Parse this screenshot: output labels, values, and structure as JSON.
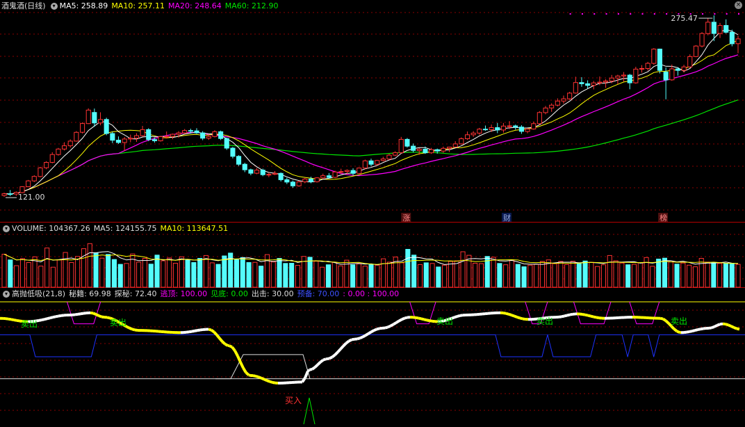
{
  "header_main": {
    "title": "酒鬼酒(日线)",
    "ma5": "MA5: 258.89",
    "ma10": "MA10: 257.11",
    "ma20": "MA20: 248.64",
    "ma60": "MA60: 212.90",
    "high_label": "275.47",
    "low_label": "121.00"
  },
  "event_markers": [
    "涨",
    "财",
    "榜"
  ],
  "header_volume": {
    "title": "VOLUME: 104367.26",
    "ma5": "MA5: 124155.75",
    "ma10": "MA10: 113647.51"
  },
  "header_indicator": {
    "title": "高抛低吸(21,8)",
    "mi_ji": "秘籍: 69.98",
    "tan_mi": "探秘: 72.40",
    "tao_ding": "逃顶: 100.00",
    "jian_di": "见底: 0.00",
    "chu_ji": "出击: 30.00",
    "yu_bei": "预备: 70.00",
    "extra": ": 0.00 : 100.00"
  },
  "signals": {
    "sell": "卖出",
    "buy": "买入"
  },
  "colors": {
    "up": "#ff3232",
    "down": "#54fcfc",
    "ma5": "#ffffff",
    "ma10": "#ffff00",
    "ma20": "#ff00ff",
    "ma60": "#00e600",
    "grid": "#8b0000",
    "blue": "#1e32ff"
  },
  "chart_data": {
    "type": "candlestick",
    "price_range": [
      121.0,
      275.47
    ],
    "candles": [
      {
        "o": 121.5,
        "h": 124.0,
        "l": 120.3,
        "c": 123.0
      },
      {
        "o": 123.0,
        "h": 126.2,
        "l": 121.0,
        "c": 122.8
      },
      {
        "o": 122.8,
        "h": 125.0,
        "l": 121.2,
        "c": 124.2
      },
      {
        "o": 124.0,
        "h": 129.5,
        "l": 123.5,
        "c": 129.0
      },
      {
        "o": 129.0,
        "h": 134.8,
        "l": 128.6,
        "c": 134.0
      },
      {
        "o": 134.0,
        "h": 138.8,
        "l": 133.0,
        "c": 137.8
      },
      {
        "o": 137.8,
        "h": 146.0,
        "l": 137.0,
        "c": 145.2
      },
      {
        "o": 145.2,
        "h": 150.8,
        "l": 144.0,
        "c": 149.8
      },
      {
        "o": 149.8,
        "h": 158.5,
        "l": 149.0,
        "c": 156.5
      },
      {
        "o": 156.5,
        "h": 162.2,
        "l": 155.6,
        "c": 161.2
      },
      {
        "o": 161.2,
        "h": 167.0,
        "l": 160.0,
        "c": 164.0
      },
      {
        "o": 164.0,
        "h": 169.5,
        "l": 162.5,
        "c": 168.0
      },
      {
        "o": 168.0,
        "h": 176.5,
        "l": 167.5,
        "c": 175.5
      },
      {
        "o": 175.5,
        "h": 184.0,
        "l": 174.5,
        "c": 183.0
      },
      {
        "o": 183.0,
        "h": 196.0,
        "l": 182.6,
        "c": 194.5
      },
      {
        "o": 192.5,
        "h": 195.8,
        "l": 180.2,
        "c": 183.5
      },
      {
        "o": 183.5,
        "h": 192.6,
        "l": 181.5,
        "c": 186.5
      },
      {
        "o": 186.5,
        "h": 188.0,
        "l": 173.0,
        "c": 174.5
      },
      {
        "o": 174.5,
        "h": 176.0,
        "l": 166.3,
        "c": 168.8
      },
      {
        "o": 168.8,
        "h": 172.0,
        "l": 165.6,
        "c": 166.8
      },
      {
        "o": 166.8,
        "h": 171.5,
        "l": 159.5,
        "c": 169.8
      },
      {
        "o": 169.8,
        "h": 173.5,
        "l": 167.0,
        "c": 170.5
      },
      {
        "o": 170.5,
        "h": 174.8,
        "l": 167.3,
        "c": 172.6
      },
      {
        "o": 172.6,
        "h": 181.0,
        "l": 172.0,
        "c": 177.8
      },
      {
        "o": 177.8,
        "h": 179.0,
        "l": 168.0,
        "c": 169.3
      },
      {
        "o": 169.3,
        "h": 171.0,
        "l": 166.7,
        "c": 168.3
      },
      {
        "o": 168.3,
        "h": 172.5,
        "l": 167.6,
        "c": 171.8
      },
      {
        "o": 171.8,
        "h": 176.2,
        "l": 170.2,
        "c": 172.0
      },
      {
        "o": 172.0,
        "h": 174.5,
        "l": 169.6,
        "c": 173.8
      },
      {
        "o": 173.8,
        "h": 176.5,
        "l": 171.0,
        "c": 175.0
      },
      {
        "o": 175.0,
        "h": 178.3,
        "l": 174.0,
        "c": 177.0
      },
      {
        "o": 177.0,
        "h": 178.6,
        "l": 174.4,
        "c": 176.7
      },
      {
        "o": 176.7,
        "h": 179.0,
        "l": 174.3,
        "c": 175.0
      },
      {
        "o": 175.0,
        "h": 176.5,
        "l": 168.8,
        "c": 170.5
      },
      {
        "o": 170.5,
        "h": 173.7,
        "l": 169.0,
        "c": 171.9
      },
      {
        "o": 171.9,
        "h": 177.3,
        "l": 171.2,
        "c": 176.0
      },
      {
        "o": 176.0,
        "h": 177.0,
        "l": 168.9,
        "c": 170.2
      },
      {
        "o": 170.2,
        "h": 171.0,
        "l": 160.5,
        "c": 162.0
      },
      {
        "o": 162.0,
        "h": 163.0,
        "l": 153.2,
        "c": 155.0
      },
      {
        "o": 155.0,
        "h": 156.0,
        "l": 146.7,
        "c": 148.2
      },
      {
        "o": 148.2,
        "h": 149.5,
        "l": 141.5,
        "c": 143.5
      },
      {
        "o": 143.5,
        "h": 144.5,
        "l": 138.8,
        "c": 140.5
      },
      {
        "o": 140.5,
        "h": 145.0,
        "l": 139.7,
        "c": 143.2
      },
      {
        "o": 143.2,
        "h": 144.5,
        "l": 138.0,
        "c": 139.3
      },
      {
        "o": 139.3,
        "h": 141.3,
        "l": 137.2,
        "c": 139.6
      },
      {
        "o": 139.6,
        "h": 142.4,
        "l": 138.9,
        "c": 140.4
      },
      {
        "o": 140.4,
        "h": 141.3,
        "l": 133.5,
        "c": 135.0
      },
      {
        "o": 135.0,
        "h": 136.7,
        "l": 131.3,
        "c": 133.0
      },
      {
        "o": 133.0,
        "h": 134.3,
        "l": 128.1,
        "c": 129.8
      },
      {
        "o": 129.8,
        "h": 134.0,
        "l": 129.0,
        "c": 133.2
      },
      {
        "o": 133.2,
        "h": 136.5,
        "l": 132.0,
        "c": 135.6
      },
      {
        "o": 135.6,
        "h": 137.6,
        "l": 132.0,
        "c": 133.3
      },
      {
        "o": 133.3,
        "h": 137.2,
        "l": 132.6,
        "c": 136.6
      },
      {
        "o": 136.6,
        "h": 140.2,
        "l": 135.7,
        "c": 138.4
      },
      {
        "o": 138.4,
        "h": 140.7,
        "l": 136.0,
        "c": 137.0
      },
      {
        "o": 137.0,
        "h": 142.7,
        "l": 136.3,
        "c": 141.6
      },
      {
        "o": 141.6,
        "h": 144.4,
        "l": 140.0,
        "c": 142.0
      },
      {
        "o": 142.0,
        "h": 143.9,
        "l": 139.6,
        "c": 142.9
      },
      {
        "o": 142.9,
        "h": 144.8,
        "l": 138.8,
        "c": 140.4
      },
      {
        "o": 140.4,
        "h": 145.5,
        "l": 139.9,
        "c": 145.0
      },
      {
        "o": 145.0,
        "h": 152.2,
        "l": 144.0,
        "c": 151.1
      },
      {
        "o": 151.1,
        "h": 153.0,
        "l": 146.5,
        "c": 148.2
      },
      {
        "o": 148.2,
        "h": 152.0,
        "l": 147.1,
        "c": 151.4
      },
      {
        "o": 151.4,
        "h": 154.6,
        "l": 150.6,
        "c": 152.7
      },
      {
        "o": 152.7,
        "h": 157.2,
        "l": 152.0,
        "c": 156.0
      },
      {
        "o": 156.0,
        "h": 159.3,
        "l": 155.0,
        "c": 158.1
      },
      {
        "o": 158.1,
        "h": 171.6,
        "l": 157.4,
        "c": 169.5
      },
      {
        "o": 169.5,
        "h": 170.6,
        "l": 162.5,
        "c": 163.7
      },
      {
        "o": 163.7,
        "h": 165.9,
        "l": 158.3,
        "c": 160.0
      },
      {
        "o": 160.0,
        "h": 162.0,
        "l": 156.3,
        "c": 161.1
      },
      {
        "o": 161.1,
        "h": 163.4,
        "l": 157.1,
        "c": 158.0
      },
      {
        "o": 158.0,
        "h": 162.2,
        "l": 157.1,
        "c": 160.7
      },
      {
        "o": 160.7,
        "h": 161.6,
        "l": 157.3,
        "c": 159.5
      },
      {
        "o": 159.5,
        "h": 163.3,
        "l": 158.0,
        "c": 161.8
      },
      {
        "o": 161.8,
        "h": 163.2,
        "l": 158.7,
        "c": 162.9
      },
      {
        "o": 162.9,
        "h": 167.9,
        "l": 162.5,
        "c": 165.6
      },
      {
        "o": 165.6,
        "h": 171.2,
        "l": 165.0,
        "c": 170.0
      },
      {
        "o": 170.0,
        "h": 176.2,
        "l": 169.0,
        "c": 173.4
      },
      {
        "o": 173.4,
        "h": 176.5,
        "l": 171.6,
        "c": 174.8
      },
      {
        "o": 174.8,
        "h": 179.3,
        "l": 173.4,
        "c": 178.2
      },
      {
        "o": 178.2,
        "h": 181.3,
        "l": 176.8,
        "c": 177.7
      },
      {
        "o": 177.7,
        "h": 182.1,
        "l": 175.8,
        "c": 179.5
      },
      {
        "o": 179.5,
        "h": 183.5,
        "l": 174.8,
        "c": 177.5
      },
      {
        "o": 177.5,
        "h": 183.5,
        "l": 175.2,
        "c": 180.8
      },
      {
        "o": 180.8,
        "h": 185.1,
        "l": 178.3,
        "c": 181.0
      },
      {
        "o": 181.0,
        "h": 182.1,
        "l": 177.8,
        "c": 180.0
      },
      {
        "o": 180.0,
        "h": 181.6,
        "l": 174.2,
        "c": 176.3
      },
      {
        "o": 176.3,
        "h": 179.1,
        "l": 174.7,
        "c": 178.3
      },
      {
        "o": 178.3,
        "h": 184.7,
        "l": 177.8,
        "c": 182.9
      },
      {
        "o": 182.9,
        "h": 193.6,
        "l": 182.0,
        "c": 192.4
      },
      {
        "o": 192.4,
        "h": 198.0,
        "l": 190.9,
        "c": 196.3
      },
      {
        "o": 196.3,
        "h": 200.3,
        "l": 193.0,
        "c": 198.7
      },
      {
        "o": 198.7,
        "h": 204.5,
        "l": 197.6,
        "c": 202.2
      },
      {
        "o": 202.2,
        "h": 206.9,
        "l": 200.0,
        "c": 204.1
      },
      {
        "o": 204.1,
        "h": 210.1,
        "l": 203.1,
        "c": 209.0
      },
      {
        "o": 209.0,
        "h": 223.0,
        "l": 208.5,
        "c": 218.0
      },
      {
        "o": 218.0,
        "h": 222.6,
        "l": 214.4,
        "c": 217.0
      },
      {
        "o": 217.0,
        "h": 219.9,
        "l": 212.9,
        "c": 215.6
      },
      {
        "o": 215.6,
        "h": 219.4,
        "l": 212.2,
        "c": 217.7
      },
      {
        "o": 217.7,
        "h": 223.2,
        "l": 215.8,
        "c": 218.4
      },
      {
        "o": 218.4,
        "h": 220.9,
        "l": 213.5,
        "c": 219.3
      },
      {
        "o": 219.3,
        "h": 224.5,
        "l": 217.4,
        "c": 221.9
      },
      {
        "o": 221.9,
        "h": 224.7,
        "l": 216.6,
        "c": 223.6
      },
      {
        "o": 223.6,
        "h": 227.0,
        "l": 218.9,
        "c": 224.4
      },
      {
        "o": 224.4,
        "h": 225.4,
        "l": 212.3,
        "c": 217.8
      },
      {
        "o": 217.8,
        "h": 231.5,
        "l": 217.0,
        "c": 229.5
      },
      {
        "o": 229.5,
        "h": 232.9,
        "l": 226.5,
        "c": 230.0
      },
      {
        "o": 230.0,
        "h": 235.7,
        "l": 228.2,
        "c": 234.4
      },
      {
        "o": 234.4,
        "h": 247.4,
        "l": 233.2,
        "c": 246.6
      },
      {
        "o": 246.6,
        "h": 247.0,
        "l": 225.8,
        "c": 228.4
      },
      {
        "o": 227.0,
        "h": 230.9,
        "l": 203.7,
        "c": 220.3
      },
      {
        "o": 220.3,
        "h": 233.4,
        "l": 219.5,
        "c": 229.7
      },
      {
        "o": 229.7,
        "h": 231.1,
        "l": 223.9,
        "c": 228.4
      },
      {
        "o": 228.4,
        "h": 233.2,
        "l": 226.5,
        "c": 231.4
      },
      {
        "o": 231.4,
        "h": 242.1,
        "l": 230.5,
        "c": 240.2
      },
      {
        "o": 240.2,
        "h": 250.0,
        "l": 239.7,
        "c": 249.2
      },
      {
        "o": 249.2,
        "h": 261.1,
        "l": 248.0,
        "c": 259.9
      },
      {
        "o": 259.9,
        "h": 273.0,
        "l": 258.4,
        "c": 269.6
      },
      {
        "o": 269.6,
        "h": 275.4,
        "l": 253.4,
        "c": 260.0
      },
      {
        "o": 260.0,
        "h": 269.0,
        "l": 256.1,
        "c": 266.8
      },
      {
        "o": 266.8,
        "h": 272.0,
        "l": 259.9,
        "c": 261.0
      },
      {
        "o": 261.0,
        "h": 263.2,
        "l": 249.0,
        "c": 251.2
      },
      {
        "o": 251.2,
        "h": 258.0,
        "l": 243.0,
        "c": 255.3
      }
    ],
    "ma5": [],
    "volume_range": [
      0,
      240000
    ],
    "volume": [
      150000,
      124000,
      98000,
      130000,
      112000,
      138000,
      96000,
      178000,
      91000,
      124000,
      158000,
      112000,
      140000,
      175000,
      198000,
      156000,
      132000,
      149000,
      126000,
      104000,
      108000,
      151000,
      114000,
      131000,
      105000,
      146000,
      120000,
      133000,
      109000,
      138000,
      126000,
      112000,
      131000,
      144000,
      111000,
      104000,
      142000,
      155000,
      125000,
      135000,
      112000,
      113000,
      96000,
      148000,
      115000,
      131000,
      108000,
      109000,
      99000,
      140000,
      136000,
      118000,
      91000,
      102000,
      113000,
      97000,
      123000,
      102000,
      106000,
      96000,
      104000,
      100000,
      129000,
      114000,
      137000,
      111000,
      172000,
      146000,
      103000,
      111000,
      108000,
      92000,
      100000,
      117000,
      120000,
      161000,
      145000,
      109000,
      107000,
      140000,
      136000,
      108000,
      102000,
      124000,
      104000,
      93000,
      100000,
      104000,
      117000,
      124000,
      107000,
      117000,
      103000,
      118000,
      109000,
      119000,
      113000,
      94000,
      102000,
      144000,
      120000,
      110000,
      102000,
      104000,
      111000,
      135000,
      95000,
      128000,
      132000,
      115000,
      105000,
      110000,
      100000,
      93000,
      131000,
      114000,
      111000,
      108000,
      107000,
      106000,
      104000
    ],
    "indicator_range": [
      0,
      100
    ],
    "mi_ji": [],
    "yu_bei_level": 70.0,
    "chu_ji_level": 30.0
  }
}
